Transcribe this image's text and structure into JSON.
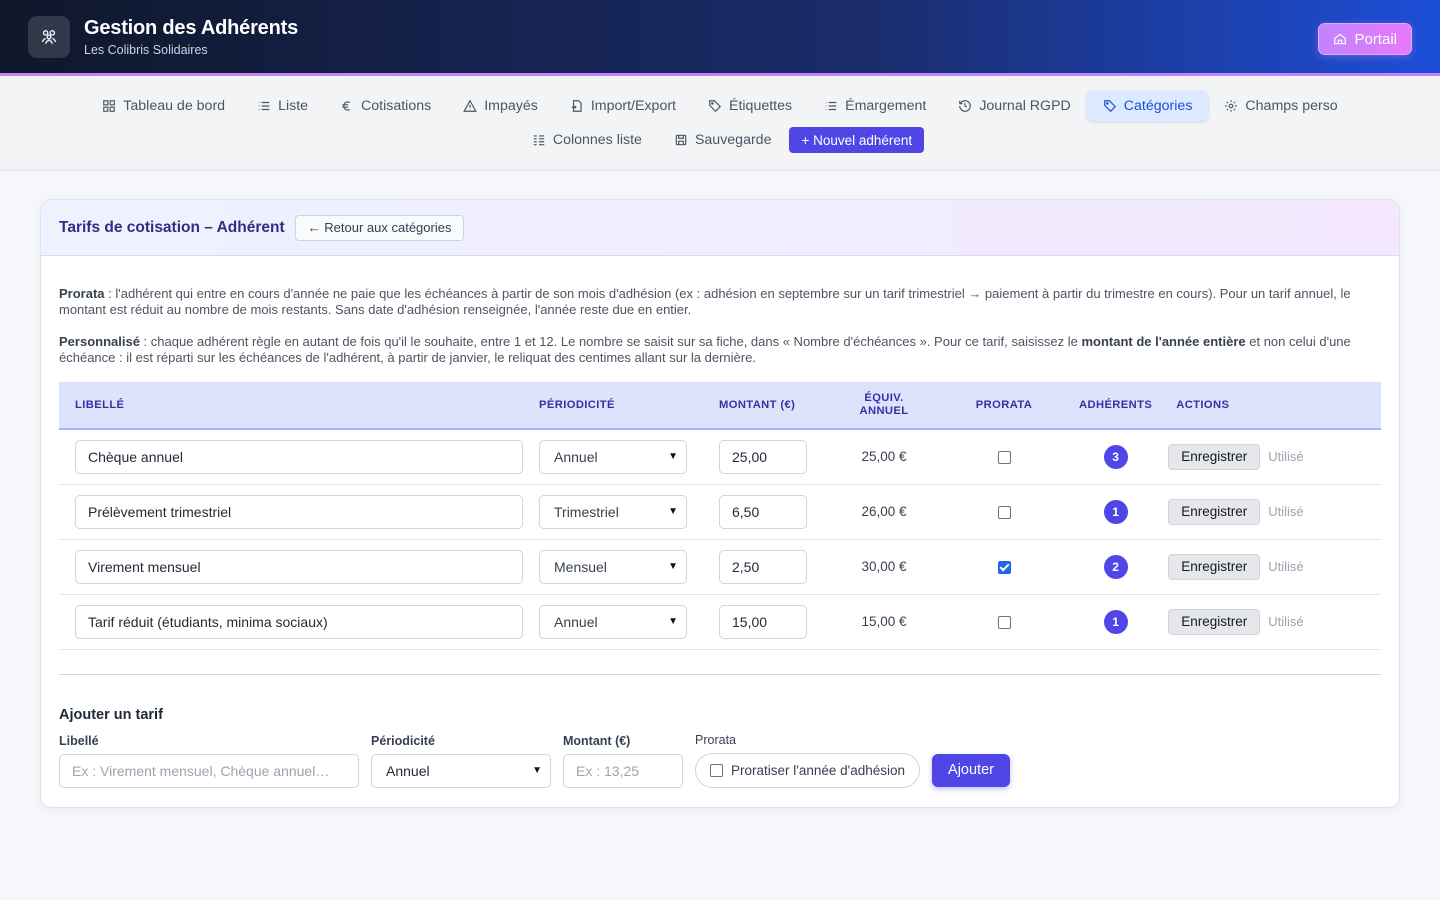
{
  "header": {
    "title": "Gestion des Adhérents",
    "subtitle": "Les Colibris Solidaires",
    "portal_label": "Portail"
  },
  "nav": {
    "row1": [
      {
        "label": "Tableau de bord",
        "icon": "dashboard-icon"
      },
      {
        "label": "Liste",
        "icon": "list-icon"
      },
      {
        "label": "Cotisations",
        "icon": "euro-icon"
      },
      {
        "label": "Impayés",
        "icon": "warning-icon"
      },
      {
        "label": "Import/Export",
        "icon": "file-transfer-icon"
      },
      {
        "label": "Étiquettes",
        "icon": "tag-icon"
      },
      {
        "label": "Émargement",
        "icon": "list-icon"
      },
      {
        "label": "Journal RGPD",
        "icon": "history-icon"
      },
      {
        "label": "Catégories",
        "icon": "tag-icon"
      },
      {
        "label": "Champs perso",
        "icon": "gear-icon"
      }
    ],
    "row2": [
      {
        "label": "Colonnes liste",
        "icon": "columns-icon"
      },
      {
        "label": "Sauvegarde",
        "icon": "save-icon"
      }
    ],
    "new_member_label": "+ Nouvel adhérent",
    "active": "Catégories"
  },
  "card": {
    "title": "Tarifs de cotisation – Adhérent",
    "back_label": "← Retour aux catégories",
    "note1_bold": "Prorata",
    "note1_text": " : l'adhérent qui entre en cours d'année ne paie que les échéances à partir de son mois d'adhésion (ex : adhésion en septembre sur un tarif trimestriel → paiement à partir du trimestre en cours). Pour un tarif annuel, le montant est réduit au nombre de mois restants. Sans date d'adhésion renseignée, l'année reste due en entier.",
    "note2_bold": "Personnalisé",
    "note2_text_a": " : chaque adhérent règle en autant de fois qu'il le souhaite, entre 1 et 12. Le nombre se saisit sur sa fiche, dans « Nombre d'échéances ». Pour ce tarif, saisissez le ",
    "note2_bold2": "montant de l'année entière",
    "note2_text_b": " et non celui d'une échéance : il est réparti sur les échéances de l'adhérent, à partir de janvier, le reliquat des centimes allant sur la dernière."
  },
  "table": {
    "headers": {
      "libelle": "Libellé",
      "periodicite": "Périodicité",
      "montant": "Montant (€)",
      "equiv_a": "Équiv.",
      "equiv_b": "annuel",
      "prorata": "Prorata",
      "adherents": "Adhérents",
      "actions": "Actions"
    },
    "rows": [
      {
        "libelle": "Chèque annuel",
        "periodicite": "Annuel",
        "montant": "25,00",
        "equiv": "25,00 €",
        "prorata": false,
        "adherents": "3",
        "save": "Enregistrer",
        "used": "Utilisé"
      },
      {
        "libelle": "Prélèvement trimestriel",
        "periodicite": "Trimestriel",
        "montant": "6,50",
        "equiv": "26,00 €",
        "prorata": false,
        "adherents": "1",
        "save": "Enregistrer",
        "used": "Utilisé"
      },
      {
        "libelle": "Virement mensuel",
        "periodicite": "Mensuel",
        "montant": "2,50",
        "equiv": "30,00 €",
        "prorata": true,
        "adherents": "2",
        "save": "Enregistrer",
        "used": "Utilisé"
      },
      {
        "libelle": "Tarif réduit (étudiants, minima sociaux)",
        "periodicite": "Annuel",
        "montant": "15,00",
        "equiv": "15,00 €",
        "prorata": false,
        "adherents": "1",
        "save": "Enregistrer",
        "used": "Utilisé"
      }
    ]
  },
  "add_form": {
    "title": "Ajouter un tarif",
    "libelle_label": "Libellé",
    "libelle_placeholder": "Ex : Virement mensuel, Chèque annuel…",
    "periodicite_label": "Périodicité",
    "periodicite_value": "Annuel",
    "montant_label": "Montant (€)",
    "montant_placeholder": "Ex : 13,25",
    "prorata_label": "Prorata",
    "prorata_checkbox": "Proratiser l'année d'adhésion",
    "submit_label": "Ajouter"
  }
}
